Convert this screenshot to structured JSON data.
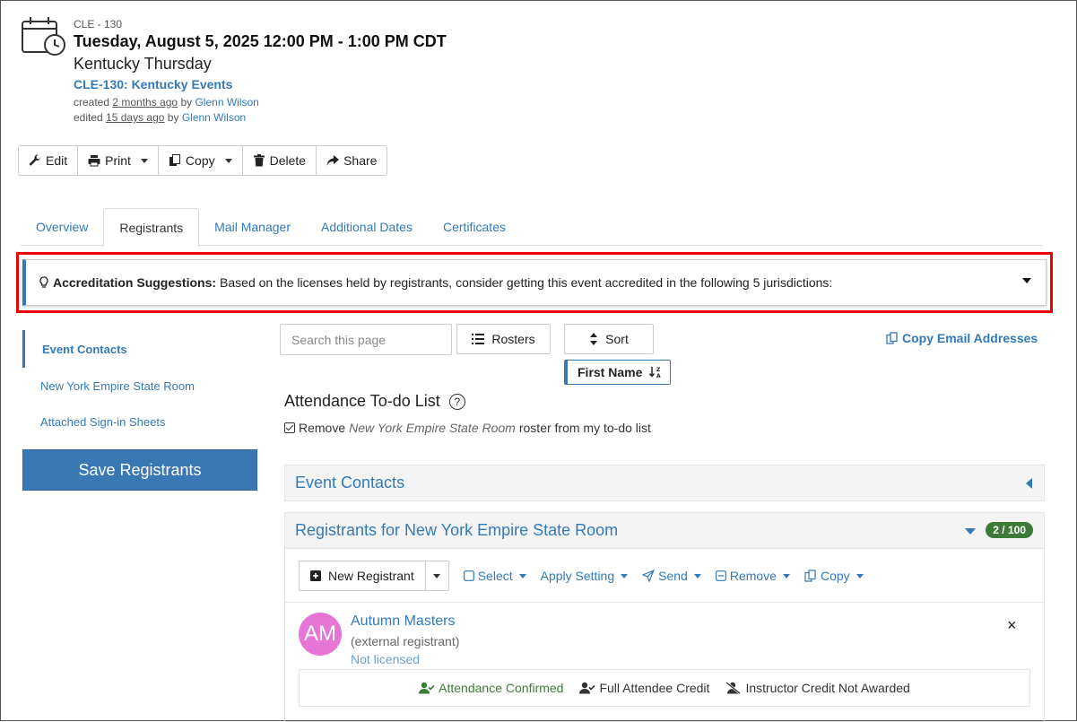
{
  "event": {
    "code": "CLE - 130",
    "datetime": "Tuesday, August 5, 2025 12:00 PM - 1:00 PM CDT",
    "title": "Kentucky Thursday",
    "program_link": "CLE-130: Kentucky Events",
    "created_prefix": "created",
    "created_ago": "2 months ago",
    "created_by_prefix": "by",
    "created_by": "Glenn Wilson",
    "edited_prefix": "edited",
    "edited_ago": "15 days ago",
    "edited_by_prefix": "by",
    "edited_by": "Glenn Wilson"
  },
  "toolbar": {
    "edit": "Edit",
    "print": "Print",
    "copy": "Copy",
    "delete": "Delete",
    "share": "Share"
  },
  "tabs": [
    {
      "label": "Overview"
    },
    {
      "label": "Registrants"
    },
    {
      "label": "Mail Manager"
    },
    {
      "label": "Additional Dates"
    },
    {
      "label": "Certificates"
    }
  ],
  "banner": {
    "heading": "Accreditation Suggestions:",
    "text": "Based on the licenses held by registrants, consider getting this event accredited in the following 5 jurisdictions:"
  },
  "left_nav": {
    "items": [
      {
        "label": "Event Contacts"
      },
      {
        "label": "New York Empire State Room"
      },
      {
        "label": "Attached Sign-in Sheets"
      }
    ],
    "save_label": "Save Registrants"
  },
  "controls": {
    "search_placeholder": "Search this page",
    "rosters": "Rosters",
    "sort": "Sort",
    "sort_field": "First Name",
    "copy_emails": "Copy Email Addresses"
  },
  "todo": {
    "title": "Attendance To-do List",
    "help": "?",
    "remove_prefix": "Remove",
    "room": "New York Empire State Room",
    "remove_suffix": "roster from my to-do list"
  },
  "panels": {
    "contacts": "Event Contacts",
    "registrants": "Registrants for New York Empire State Room",
    "count": "2 / 100"
  },
  "actions": {
    "new_registrant": "New Registrant",
    "select": "Select",
    "apply_setting": "Apply Setting",
    "send": "Send",
    "remove": "Remove",
    "copy": "Copy"
  },
  "registrant": {
    "initials": "AM",
    "name": "Autumn Masters",
    "type": "(external registrant)",
    "license": "Not licensed",
    "close": "×",
    "attendance": "Attendance Confirmed",
    "attendee_credit": "Full Attendee Credit",
    "instructor_credit": "Instructor Credit Not Awarded"
  },
  "colors": {
    "link": "#337ab7",
    "primary": "#3a78b5",
    "highlight": "#e00000",
    "success": "#3d7a3a",
    "avatar": "#e675d6"
  }
}
